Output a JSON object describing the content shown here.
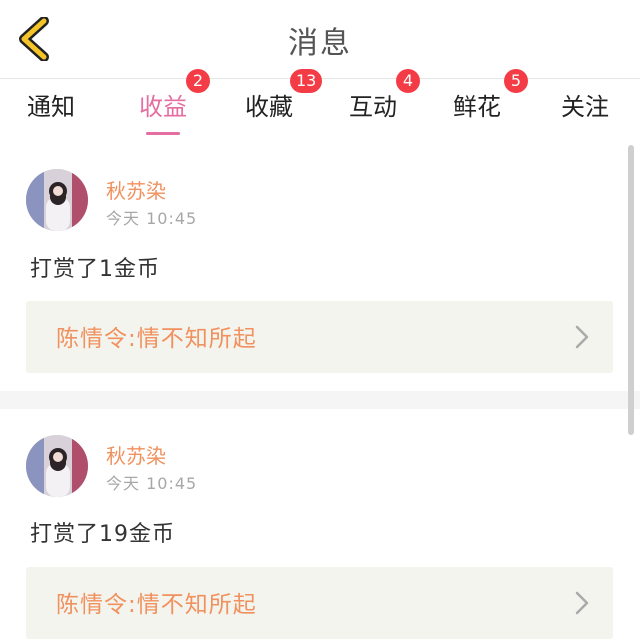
{
  "header": {
    "title": "消息",
    "back_icon": "chevron-left-icon",
    "back_color": "#f4c428"
  },
  "tabs": [
    {
      "label": "通知",
      "badge": ""
    },
    {
      "label": "收益",
      "badge": "2",
      "active": true
    },
    {
      "label": "收藏",
      "badge": "13"
    },
    {
      "label": "互动",
      "badge": "4"
    },
    {
      "label": "鲜花",
      "badge": "5"
    },
    {
      "label": "关注",
      "badge": ""
    }
  ],
  "colors": {
    "accent": "#e46ea0",
    "badge": "#f33c46",
    "name": "#f0915e"
  },
  "messages": [
    {
      "user": "秋苏染",
      "time": "今天  10:45",
      "text": "打赏了1金币",
      "reference": "陈情令:情不知所起"
    },
    {
      "user": "秋苏染",
      "time": "今天  10:45",
      "text": "打赏了19金币",
      "reference": "陈情令:情不知所起"
    }
  ]
}
